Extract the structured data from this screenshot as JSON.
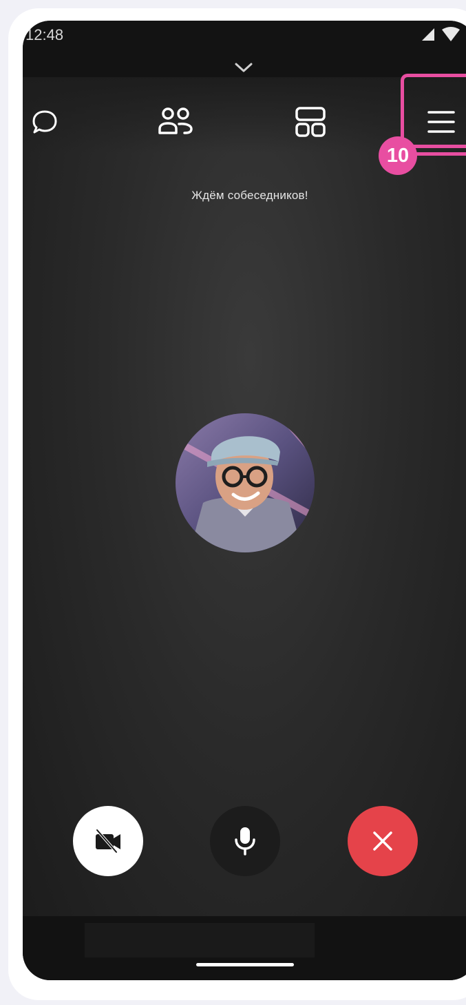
{
  "status_bar": {
    "time": "12:48"
  },
  "header": {
    "chat_icon": "chat-bubble-icon",
    "participants_icon": "participants-icon",
    "layout_icon": "layout-grid-icon",
    "menu_icon": "menu-icon"
  },
  "main": {
    "waiting_text": "Ждём собеседников!"
  },
  "controls": {
    "camera_icon": "camera-off-icon",
    "mic_icon": "microphone-icon",
    "end_call_icon": "close-icon",
    "end_call_color": "#e5434a"
  },
  "annotation": {
    "badge_number": "10",
    "color": "#e84ea1"
  }
}
